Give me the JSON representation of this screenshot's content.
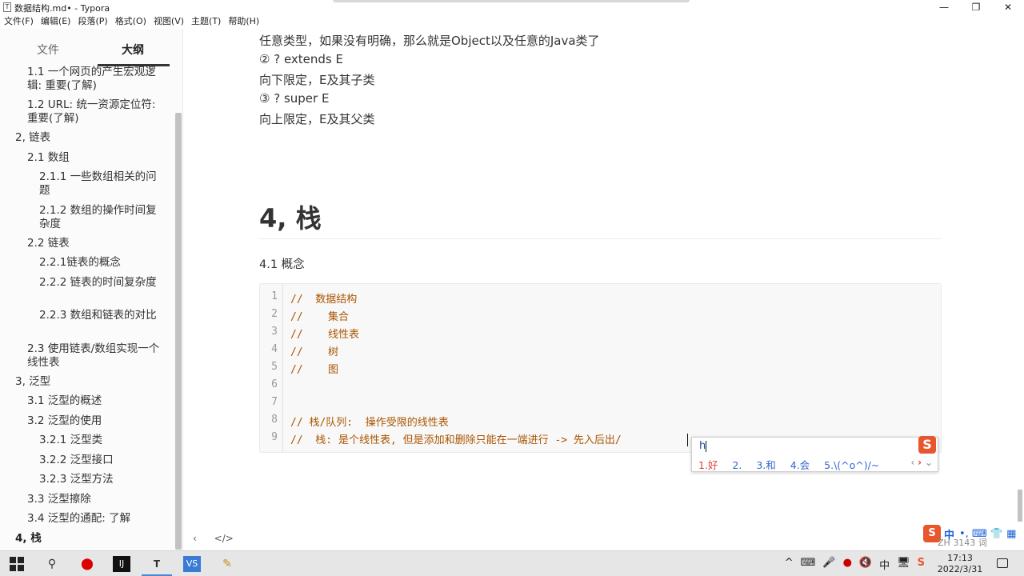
{
  "window": {
    "title": "数据结构.md• - Typora",
    "app_icon": "T",
    "controls": [
      "—",
      "❐",
      "✕"
    ]
  },
  "menubar": [
    "文件(F)",
    "编辑(E)",
    "段落(P)",
    "格式(O)",
    "视图(V)",
    "主题(T)",
    "帮助(H)"
  ],
  "sidebar": {
    "tabs": [
      "文件",
      "大纲"
    ],
    "active_tab": "大纲",
    "outline": [
      {
        "label": "1.1 一个网页的产生宏观逻辑: 重要(了解)",
        "level": 2
      },
      {
        "label": "1.2 URL: 统一资源定位符: 重要(了解)",
        "level": 2
      },
      {
        "label": "2, 链表",
        "level": 1
      },
      {
        "label": "2.1 数组",
        "level": 2
      },
      {
        "label": "2.1.1 一些数组相关的问题",
        "level": 3
      },
      {
        "label": "2.1.2 数组的操作时间复杂度",
        "level": 3
      },
      {
        "label": "2.2 链表",
        "level": 2
      },
      {
        "label": "2.2.1链表的概念",
        "level": 3
      },
      {
        "label": "2.2.2 链表的时间复杂度",
        "level": 3
      },
      {
        "label": "2.2.3 数组和链表的对比",
        "level": 3
      },
      {
        "label": "2.3 使用链表/数组实现一个线性表",
        "level": 2
      },
      {
        "label": "3, 泛型",
        "level": 1
      },
      {
        "label": "3.1 泛型的概述",
        "level": 2
      },
      {
        "label": "3.2 泛型的使用",
        "level": 2
      },
      {
        "label": "3.2.1 泛型类",
        "level": 3
      },
      {
        "label": "3.2.2 泛型接口",
        "level": 3
      },
      {
        "label": "3.2.3 泛型方法",
        "level": 3
      },
      {
        "label": "3.3 泛型擦除",
        "level": 2
      },
      {
        "label": "3.4 泛型的通配: 了解",
        "level": 2
      },
      {
        "label": "4, 栈",
        "level": 1,
        "active": true
      }
    ],
    "footer_icons": [
      "‹",
      "</>"
    ]
  },
  "document": {
    "paragraphs": [
      "任意类型，如果没有明确，那么就是Object以及任意的Java类了",
      "② ? extends E",
      "向下限定，E及其子类",
      "③ ? super E",
      "向上限定，E及其父类"
    ],
    "heading": "4, 栈",
    "subheading": "4.1 概念",
    "code_lines": [
      {
        "n": "1",
        "text": "//  数据结构"
      },
      {
        "n": "2",
        "text": "//    集合"
      },
      {
        "n": "3",
        "text": "//    线性表"
      },
      {
        "n": "4",
        "text": "//    树"
      },
      {
        "n": "5",
        "text": "//    图"
      },
      {
        "n": "6",
        "text": ""
      },
      {
        "n": "7",
        "text": ""
      },
      {
        "n": "8",
        "text": "// 栈/队列:  操作受限的线性表"
      },
      {
        "n": "9",
        "text": "//  栈: 是个线性表, 但是添加和删除只能在一端进行 -> 先入后出/ "
      }
    ]
  },
  "ime": {
    "input": "h",
    "candidates": [
      "1.好",
      "2.  ",
      "3.和",
      "4.会",
      "5.\\(^o^)/~"
    ],
    "nav": [
      "‹",
      "›",
      "⌄"
    ],
    "logo": "S"
  },
  "status": {
    "ime_logo": "S",
    "lang": "中",
    "symbols": "•, ⌨ 👕 ▦",
    "wordcount": "3143 词",
    "ime_lang_short": "ZH"
  },
  "taskbar": {
    "apps": [
      "search-icon",
      "record-icon",
      "intellij-icon",
      "typora-icon",
      "vscode-icon",
      "paint-icon"
    ],
    "tray": [
      "^",
      "⌨",
      "🎤",
      "●",
      "🔇",
      "中",
      "🖥",
      "S"
    ],
    "time": "17:13",
    "date": "2022/3/31"
  }
}
